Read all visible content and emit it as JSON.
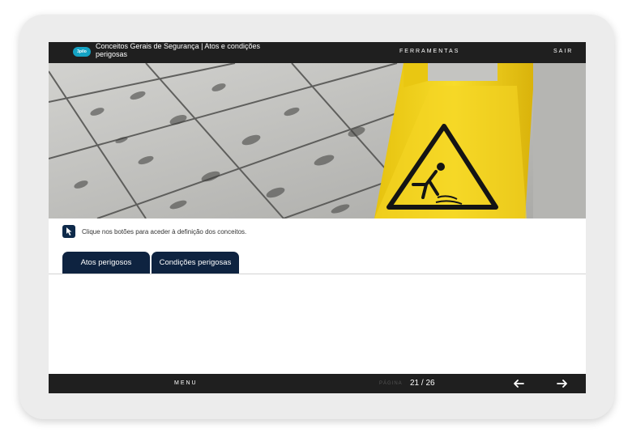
{
  "header": {
    "logo_text": "3pilo",
    "course_title": "Conceitos Gerais de Segurança | Atos e condições perigosas",
    "tools_label": "FERRAMENTAS",
    "exit_label": "SAIR"
  },
  "hero": {
    "image_subject": "wet floor with footprints and yellow slippery-floor warning sign"
  },
  "content": {
    "instruction": "Clique nos botões para aceder à definição dos conceitos.",
    "tabs": [
      {
        "label": "Atos perigosos"
      },
      {
        "label": "Condições perigosas"
      }
    ]
  },
  "footer": {
    "menu_label": "MENU",
    "page_label": "PÁGINA",
    "page_number": "21 / 26"
  },
  "colors": {
    "bar": "#1f1f1f",
    "tab": "#0e2340",
    "logo": "#14a3c4",
    "sign_yellow": "#f3d21b"
  }
}
